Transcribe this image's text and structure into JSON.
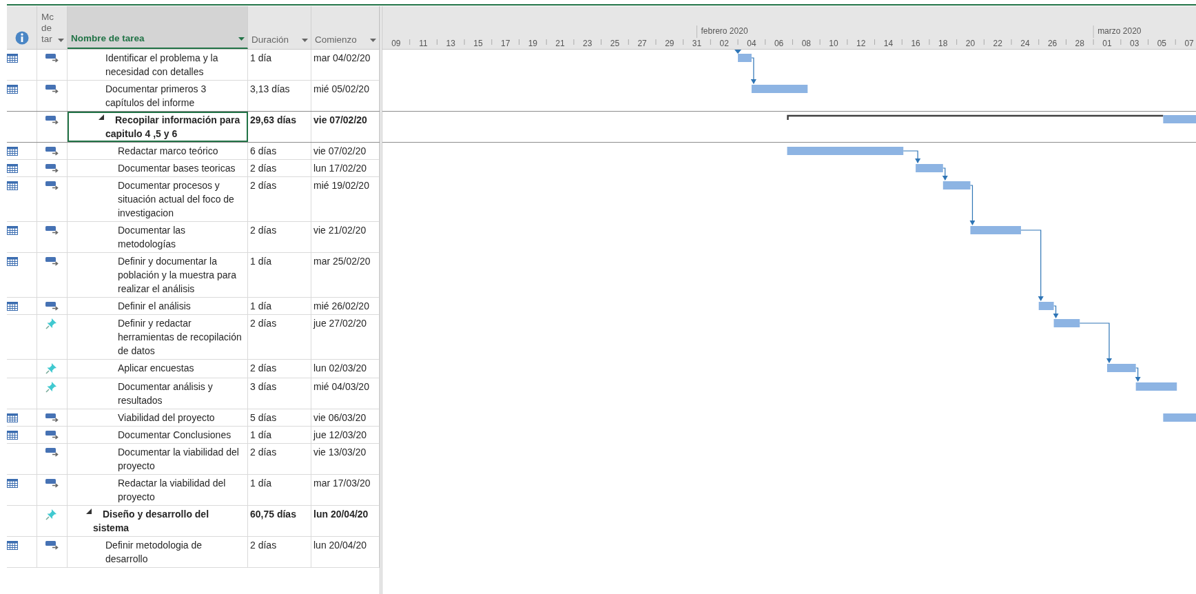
{
  "columns": [
    {
      "kind": "info",
      "selected": false
    },
    {
      "kind": "mode",
      "label": "Mc de tar",
      "selected": false
    },
    {
      "kind": "name",
      "label": "Nombre de tarea",
      "selected": true
    },
    {
      "kind": "duration",
      "label": "Duración",
      "selected": false
    },
    {
      "kind": "start",
      "label": "Comienzo",
      "selected": false
    }
  ],
  "tasks": [
    {
      "children": [
        {
          "name": "Identificar el problema y la necesidad con detalles",
          "duration": "1 día",
          "start": "mar 04/02/20",
          "kind": "task",
          "manually_scheduled": false,
          "calendar": true,
          "selected": false
        },
        {
          "name": "Documentar primeros 3 capítulos del informe",
          "duration": "3,13 días",
          "start": "mié 05/02/20",
          "kind": "task",
          "manually_scheduled": false,
          "calendar": true,
          "selected": false
        },
        {
          "name": "Recopilar información para capitulo 4 ,5 y 6",
          "duration": "29,63 días",
          "start": "vie 07/02/20",
          "kind": "summary",
          "manually_scheduled": false,
          "calendar": false,
          "selected": true,
          "expanded": true,
          "children": [
            {
              "name": "Redactar marco teórico",
              "duration": "6 días",
              "start": "vie 07/02/20",
              "kind": "task",
              "manually_scheduled": false,
              "calendar": true,
              "selected": false
            },
            {
              "name": "Documentar bases teoricas",
              "duration": "2 días",
              "start": "lun 17/02/20",
              "kind": "task",
              "manually_scheduled": false,
              "calendar": true,
              "selected": false
            },
            {
              "name": "Documentar procesos y situación actual del foco de investigacion",
              "duration": "2 días",
              "start": "mié 19/02/20",
              "kind": "task",
              "manually_scheduled": false,
              "calendar": true,
              "selected": false
            },
            {
              "name": "Documentar las metodologías",
              "duration": "2 días",
              "start": "vie 21/02/20",
              "kind": "task",
              "manually_scheduled": false,
              "calendar": true,
              "selected": false
            },
            {
              "name": "Definir y documentar la población y la muestra para realizar el análisis",
              "duration": "1 día",
              "start": "mar 25/02/20",
              "kind": "task",
              "manually_scheduled": false,
              "calendar": true,
              "selected": false
            },
            {
              "name": "Definir el análisis",
              "duration": "1 día",
              "start": "mié 26/02/20",
              "kind": "task",
              "manually_scheduled": false,
              "calendar": true,
              "selected": false
            },
            {
              "name": "Definir y redactar herramientas de recopilación de datos",
              "duration": "2 días",
              "start": "jue 27/02/20",
              "kind": "task",
              "manually_scheduled": true,
              "calendar": false,
              "selected": false
            },
            {
              "name": "Aplicar encuestas",
              "duration": "2 días",
              "start": "lun 02/03/20",
              "kind": "task",
              "manually_scheduled": true,
              "calendar": false,
              "selected": false
            },
            {
              "name": "Documentar análisis y resultados",
              "duration": "3 días",
              "start": "mié 04/03/20",
              "kind": "task",
              "manually_scheduled": true,
              "calendar": false,
              "selected": false
            },
            {
              "name": "Viabilidad del proyecto",
              "duration": "5 días",
              "start": "vie 06/03/20",
              "kind": "task",
              "manually_scheduled": false,
              "calendar": true,
              "selected": false
            },
            {
              "name": "Documentar Conclusiones",
              "duration": "1 día",
              "start": "jue 12/03/20",
              "kind": "task",
              "manually_scheduled": false,
              "calendar": true,
              "selected": false
            },
            {
              "name": "Documentar la viabilidad del proyecto",
              "duration": "2 días",
              "start": "vie 13/03/20",
              "kind": "task",
              "manually_scheduled": false,
              "calendar": false,
              "selected": false
            },
            {
              "name": "Redactar la viabilidad del proyecto",
              "duration": "1 día",
              "start": "mar 17/03/20",
              "kind": "task",
              "manually_scheduled": false,
              "calendar": true,
              "selected": false
            }
          ]
        }
      ]
    },
    {
      "name": "Diseño y desarrollo del sistema",
      "duration": "60,75 días",
      "start": "lun 20/04/20",
      "kind": "summary",
      "manually_scheduled": true,
      "calendar": false,
      "selected": false,
      "expanded": true,
      "children": [
        {
          "name": "Definir metodologia de desarrollo",
          "duration": "2 días",
          "start": "lun 20/04/20",
          "kind": "task",
          "manually_scheduled": false,
          "calendar": true,
          "selected": false
        }
      ]
    }
  ],
  "timescale": {
    "months": [
      "febrero 2020",
      "marzo 2020"
    ],
    "days": [
      "09",
      "11",
      "13",
      "15",
      "17",
      "19",
      "21",
      "23",
      "25",
      "27",
      "29",
      "31",
      "02",
      "04",
      "06",
      "08",
      "10",
      "12",
      "14",
      "16",
      "18",
      "20",
      "22",
      "24",
      "26",
      "28",
      "01",
      "03",
      "05",
      "07"
    ]
  }
}
